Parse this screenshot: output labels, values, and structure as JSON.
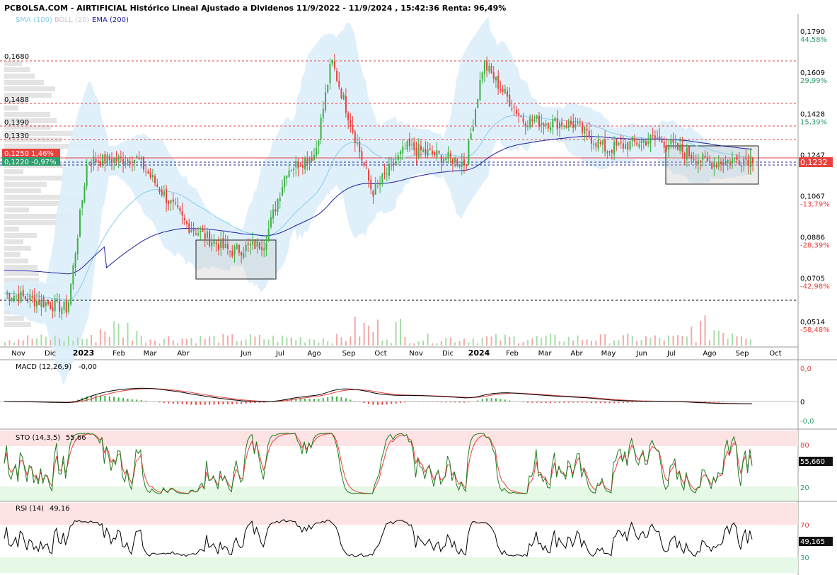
{
  "header": {
    "title": "PCBOLSA.COM - AIRTIFICIAL Histórico Lineal Ajustado a Dividenos 11/9/2022 - 11/9/2024 , 15:42:36 Renta: 96,49%",
    "legend_sma": "SMA (100)",
    "legend_boll": "BOLL (20)",
    "legend_ema": "EMA (200)"
  },
  "colors": {
    "up": "#3cb043",
    "down": "#e8423f",
    "sma": "#87ceeb",
    "ema": "#2020a0",
    "band_fill": "#dbeefb",
    "oversold": "#e6f8e6",
    "overbought": "#fde3e3",
    "green_text": "#2f9e6e",
    "red_text": "#e8423f"
  },
  "chart_data": [
    {
      "type": "candlestick",
      "name": "price",
      "y_ticks": [
        "0,1790",
        "0,1609",
        "0,1428",
        "0,1247",
        "0,1067",
        "0,0886",
        "0,0705",
        "0,0514"
      ],
      "y_pct": [
        "44,58%",
        "29,99%",
        "15,39%",
        "",
        "-13,79%",
        "-28,39%",
        "-42,98%",
        "-58,48%"
      ],
      "months": [
        "Nov",
        "Dic",
        "2023",
        "Feb",
        "Mar",
        "Abr",
        "Jun",
        "Jul",
        "Ago",
        "Sep",
        "Oct",
        "Nov",
        "Dic",
        "2024",
        "Feb",
        "Mar",
        "Abr",
        "May",
        "Jun",
        "Jul",
        "Ago",
        "Sep",
        "Oct"
      ],
      "left_levels": [
        "0,1680",
        "0,1488",
        "0,1390",
        "0,1330"
      ],
      "current_price": "0,1232",
      "badge_top": "0,1250  1,46%",
      "badge_bottom": "0,1220  -0,97%",
      "key_points": [
        {
          "date": "2022-11",
          "close": 0.064
        },
        {
          "date": "2022-12-28",
          "close": 0.057
        },
        {
          "date": "2023-01-15",
          "close": 0.122
        },
        {
          "date": "2023-03-01",
          "close": 0.123
        },
        {
          "date": "2023-04-15",
          "close": 0.094
        },
        {
          "date": "2023-05-25",
          "close": 0.082
        },
        {
          "date": "2023-06-25",
          "close": 0.086
        },
        {
          "date": "2023-07-15",
          "close": 0.118
        },
        {
          "date": "2023-08-10",
          "close": 0.125
        },
        {
          "date": "2023-08-25",
          "close": 0.166
        },
        {
          "date": "2023-10-01",
          "close": 0.108
        },
        {
          "date": "2023-11-01",
          "close": 0.128
        },
        {
          "date": "2023-12-25",
          "close": 0.121
        },
        {
          "date": "2024-01-10",
          "close": 0.165
        },
        {
          "date": "2024-02-15",
          "close": 0.14
        },
        {
          "date": "2024-04-01",
          "close": 0.138
        },
        {
          "date": "2024-05-01",
          "close": 0.127
        },
        {
          "date": "2024-06-15",
          "close": 0.132
        },
        {
          "date": "2024-08-01",
          "close": 0.121
        },
        {
          "date": "2024-09-11",
          "close": 0.1232
        }
      ]
    },
    {
      "type": "line",
      "name": "MACD",
      "label": "MACD (12,26,9)",
      "value": "-0,00",
      "y_ticks": [
        "0,0",
        "0",
        "-0,0"
      ]
    },
    {
      "type": "line",
      "name": "STO",
      "label": "STO (14,3,5)",
      "value": "55,66",
      "y_ticks": [
        "80",
        "20"
      ],
      "badge": "55,660"
    },
    {
      "type": "line",
      "name": "RSI",
      "label": "RSI (14)",
      "value": "49,16",
      "y_ticks": [
        "70",
        "30"
      ],
      "badge": "49,165"
    }
  ]
}
